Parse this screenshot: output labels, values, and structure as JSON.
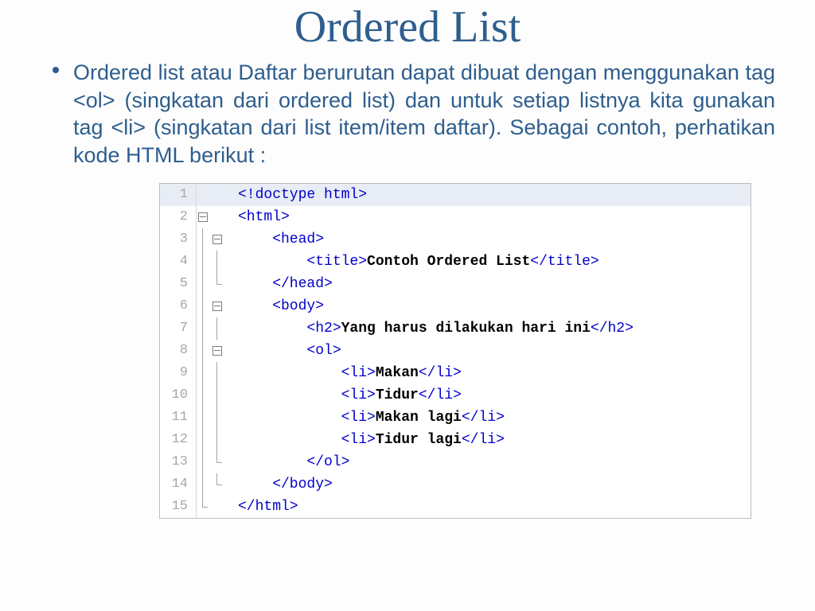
{
  "title": "Ordered List",
  "paragraph": "Ordered list atau Daftar berurutan dapat dibuat dengan menggunakan tag <ol> (singkatan dari ordered list) dan untuk setiap listnya kita gunakan tag <li> (singkatan dari list item/item daftar). Sebagai contoh, perhatikan kode HTML berikut :",
  "code_lines": [
    {
      "n": "1",
      "hl": true,
      "fold": "",
      "pre_tag": "<!doctype html>",
      "text": "",
      "post_tag": ""
    },
    {
      "n": "2",
      "hl": false,
      "fold": "fold",
      "pre_tag": "<html>",
      "text": "",
      "post_tag": ""
    },
    {
      "n": "3",
      "hl": false,
      "fold": "fold-i",
      "pre_tag": "    <head>",
      "text": "",
      "post_tag": ""
    },
    {
      "n": "4",
      "hl": false,
      "fold": "line-i",
      "pre_tag": "        <title>",
      "text": "Contoh Ordered List",
      "post_tag": "</title>"
    },
    {
      "n": "5",
      "hl": false,
      "fold": "end-i",
      "pre_tag": "    </head>",
      "text": "",
      "post_tag": ""
    },
    {
      "n": "6",
      "hl": false,
      "fold": "fold-i",
      "pre_tag": "    <body>",
      "text": "",
      "post_tag": ""
    },
    {
      "n": "7",
      "hl": false,
      "fold": "line-i",
      "pre_tag": "        <h2>",
      "text": "Yang harus dilakukan hari ini",
      "post_tag": "</h2>"
    },
    {
      "n": "8",
      "hl": false,
      "fold": "fold-i",
      "pre_tag": "        <ol>",
      "text": "",
      "post_tag": ""
    },
    {
      "n": "9",
      "hl": false,
      "fold": "line-i",
      "pre_tag": "            <li>",
      "text": "Makan",
      "post_tag": "</li>"
    },
    {
      "n": "10",
      "hl": false,
      "fold": "line-i",
      "pre_tag": "            <li>",
      "text": "Tidur",
      "post_tag": "</li>"
    },
    {
      "n": "11",
      "hl": false,
      "fold": "line-i",
      "pre_tag": "            <li>",
      "text": "Makan lagi",
      "post_tag": "</li>"
    },
    {
      "n": "12",
      "hl": false,
      "fold": "line-i",
      "pre_tag": "            <li>",
      "text": "Tidur lagi",
      "post_tag": "</li>"
    },
    {
      "n": "13",
      "hl": false,
      "fold": "end-i",
      "pre_tag": "        </ol>",
      "text": "",
      "post_tag": ""
    },
    {
      "n": "14",
      "hl": false,
      "fold": "end-i",
      "pre_tag": "    </body>",
      "text": "",
      "post_tag": ""
    },
    {
      "n": "15",
      "hl": false,
      "fold": "end",
      "pre_tag": "</html>",
      "text": "",
      "post_tag": ""
    }
  ]
}
